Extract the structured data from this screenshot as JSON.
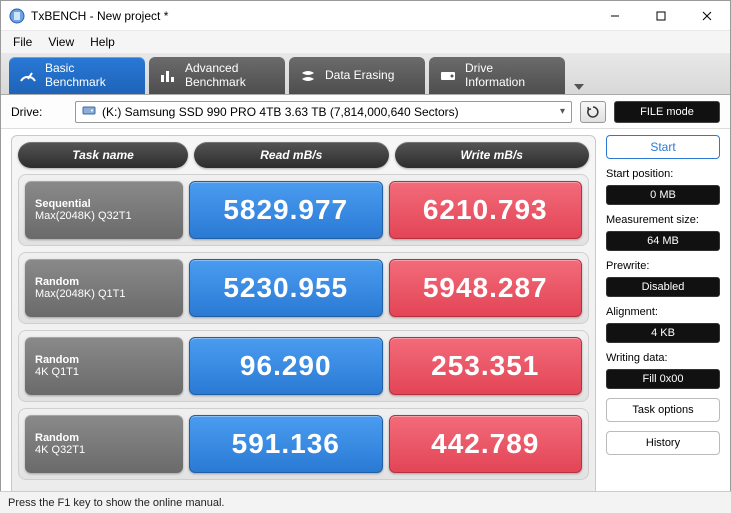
{
  "window": {
    "title": "TxBENCH - New project *"
  },
  "menu": {
    "file": "File",
    "view": "View",
    "help": "Help"
  },
  "tabs": {
    "basic": "Basic\nBenchmark",
    "advanced": "Advanced\nBenchmark",
    "erase": "Data Erasing",
    "drive": "Drive\nInformation"
  },
  "drive": {
    "label": "Drive:",
    "selected": "(K:) Samsung SSD 990 PRO 4TB  3.63 TB (7,814,000,640 Sectors)",
    "file_mode": "FILE mode"
  },
  "headers": {
    "task": "Task name",
    "read": "Read mB/s",
    "write": "Write mB/s"
  },
  "tests": [
    {
      "name1": "Sequential",
      "name2": "Max(2048K) Q32T1",
      "read": "5829.977",
      "write": "6210.793"
    },
    {
      "name1": "Random",
      "name2": "Max(2048K) Q1T1",
      "read": "5230.955",
      "write": "5948.287"
    },
    {
      "name1": "Random",
      "name2": "4K Q1T1",
      "read": "96.290",
      "write": "253.351"
    },
    {
      "name1": "Random",
      "name2": "4K Q32T1",
      "read": "591.136",
      "write": "442.789"
    }
  ],
  "side": {
    "start": "Start",
    "start_pos_label": "Start position:",
    "start_pos_value": "0 MB",
    "meas_label": "Measurement size:",
    "meas_value": "64 MB",
    "prewrite_label": "Prewrite:",
    "prewrite_value": "Disabled",
    "align_label": "Alignment:",
    "align_value": "4 KB",
    "wdata_label": "Writing data:",
    "wdata_value": "Fill 0x00",
    "task_options": "Task options",
    "history": "History"
  },
  "status": "Press the F1 key to show the online manual."
}
